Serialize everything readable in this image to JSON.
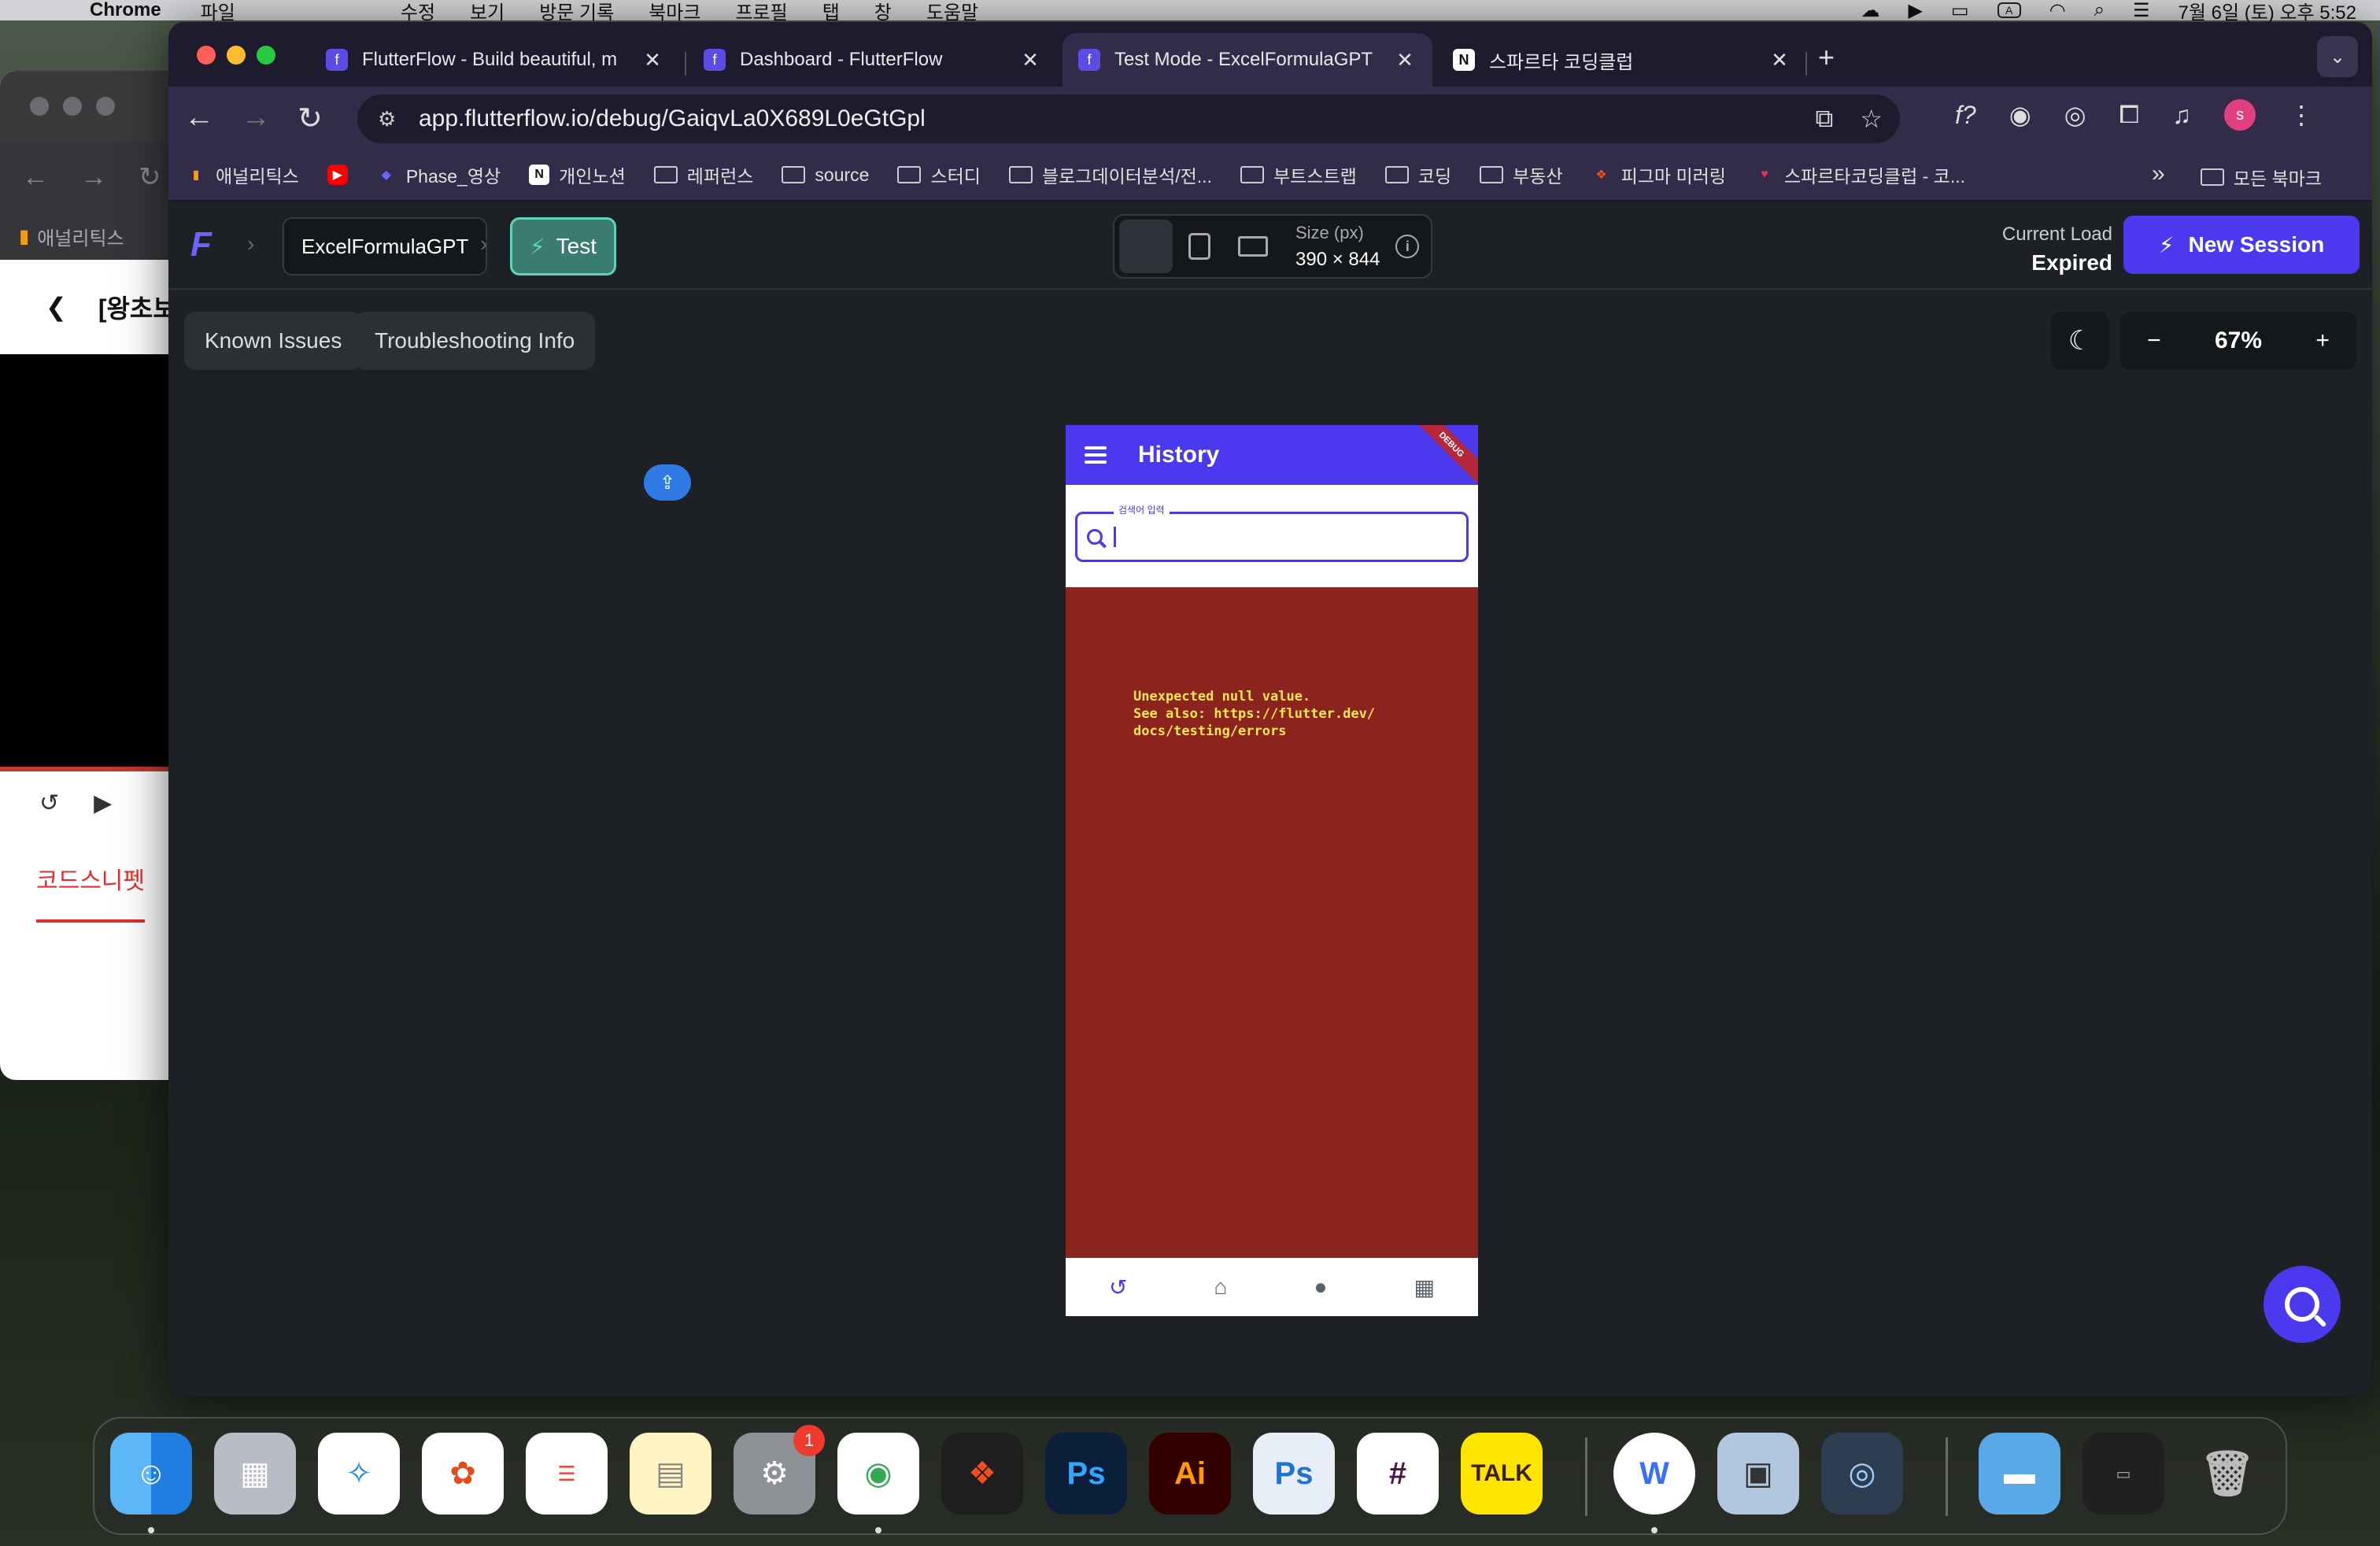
{
  "menubar": {
    "app_name": "Chrome",
    "items": [
      "파일",
      "수정",
      "보기",
      "방문 기록",
      "북마크",
      "프로필",
      "탭",
      "창",
      "도움말"
    ],
    "input_indicator": "A",
    "clock": "7월 6일 (토) 오후 5:52"
  },
  "bg_window": {
    "bookmark": "애널리틱스",
    "back_title": "[왕초보",
    "tab_label": "코드스니펫"
  },
  "tabs": [
    {
      "title": "FlutterFlow - Build beautiful, m",
      "favicon": "flutterflow-icon"
    },
    {
      "title": "Dashboard - FlutterFlow",
      "favicon": "flutterflow-icon"
    },
    {
      "title": "Test Mode - ExcelFormulaGPT",
      "favicon": "flutterflow-icon",
      "active": true
    },
    {
      "title": "스파르타 코딩클럽",
      "favicon": "notion-icon"
    }
  ],
  "address_bar": {
    "url": "app.flutterflow.io/debug/GaiqvLa0X689L0eGtGpl"
  },
  "profile_initial": "s",
  "bookmarks": [
    {
      "label": "애널리틱스",
      "icon": "analytics-icon"
    },
    {
      "label": "",
      "icon": "youtube-icon"
    },
    {
      "label": "Phase_영상",
      "icon": "diamond-icon"
    },
    {
      "label": "개인노션",
      "icon": "notion-icon"
    },
    {
      "label": "레퍼런스",
      "icon": "folder-icon"
    },
    {
      "label": "source",
      "icon": "folder-icon"
    },
    {
      "label": "스터디",
      "icon": "folder-icon"
    },
    {
      "label": "블로그데이터분석/전...",
      "icon": "folder-icon"
    },
    {
      "label": "부트스트랩",
      "icon": "folder-icon"
    },
    {
      "label": "코딩",
      "icon": "folder-icon"
    },
    {
      "label": "부동산",
      "icon": "folder-icon"
    },
    {
      "label": "피그마 미러링",
      "icon": "figma-icon"
    },
    {
      "label": "스파르타코딩클럽 - 코...",
      "icon": "heart-icon"
    }
  ],
  "all_bookmarks_label": "모든 북마크",
  "ff_header": {
    "project": "ExcelFormulaGPT",
    "mode": "Test",
    "size_label": "Size (px)",
    "size_value": "390 × 844",
    "load_label": "Current Load",
    "load_value": "Expired",
    "new_session": "New Session"
  },
  "ff_toolbar": {
    "known_issues": "Known Issues",
    "troubleshooting": "Troubleshooting Info",
    "zoom": "67%",
    "zoom_minus": "−",
    "zoom_plus": "+"
  },
  "app_preview": {
    "title": "History",
    "debug_banner": "DEBUG",
    "search_label": "검색어 입력",
    "error": "Unexpected null value.\nSee also: https://flutter.dev/\ndocs/testing/errors",
    "nav_items": [
      "history-icon",
      "home-icon",
      "person-icon",
      "grid-icon"
    ]
  },
  "dock": {
    "apps": [
      "Finder",
      "Launchpad",
      "Safari",
      "Photos",
      "Reminders",
      "Notes",
      "System Settings",
      "Chrome",
      "Figma",
      "Photoshop",
      "Illustrator",
      "Photoshop Beta",
      "Slack",
      "KakaoTalk",
      "Whale",
      "Preview",
      "QuickTime",
      "Folder",
      "Screenshot",
      "Trash"
    ],
    "settings_badge": "1",
    "kakao_label": "TALK",
    "ps_label": "Ps",
    "ai_label": "Ai",
    "whale_label": "W"
  },
  "colors": {
    "flutterflow_primary": "#4b39ef",
    "error_bg": "#8b241d",
    "error_text": "#f3e650",
    "test_accent": "#5fd3b8"
  }
}
